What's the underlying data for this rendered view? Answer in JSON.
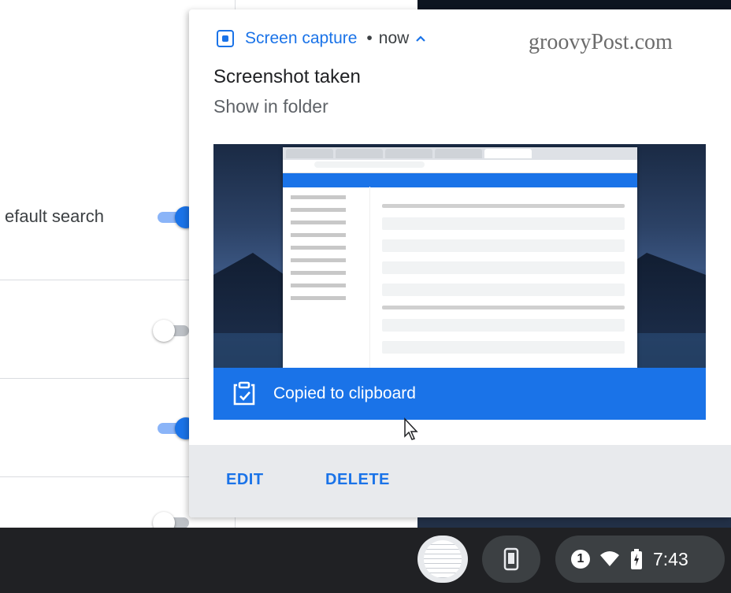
{
  "background": {
    "setting_label": "efault search"
  },
  "notification": {
    "app_name": "Screen capture",
    "separator": "•",
    "time": "now",
    "title": "Screenshot taken",
    "subtitle": "Show in folder",
    "clipboard_text": "Copied to clipboard",
    "actions": {
      "edit": "EDIT",
      "delete": "DELETE"
    }
  },
  "watermark": "groovyPost.com",
  "shelf": {
    "notification_count": "1",
    "clock": "7:43"
  },
  "colors": {
    "accent": "#1a73e8",
    "shelf": "#202124"
  },
  "icons": [
    "screen-capture-icon",
    "chevron-up-icon",
    "clipboard-check-icon",
    "cursor-icon",
    "phone-icon",
    "wifi-icon",
    "battery-icon"
  ]
}
